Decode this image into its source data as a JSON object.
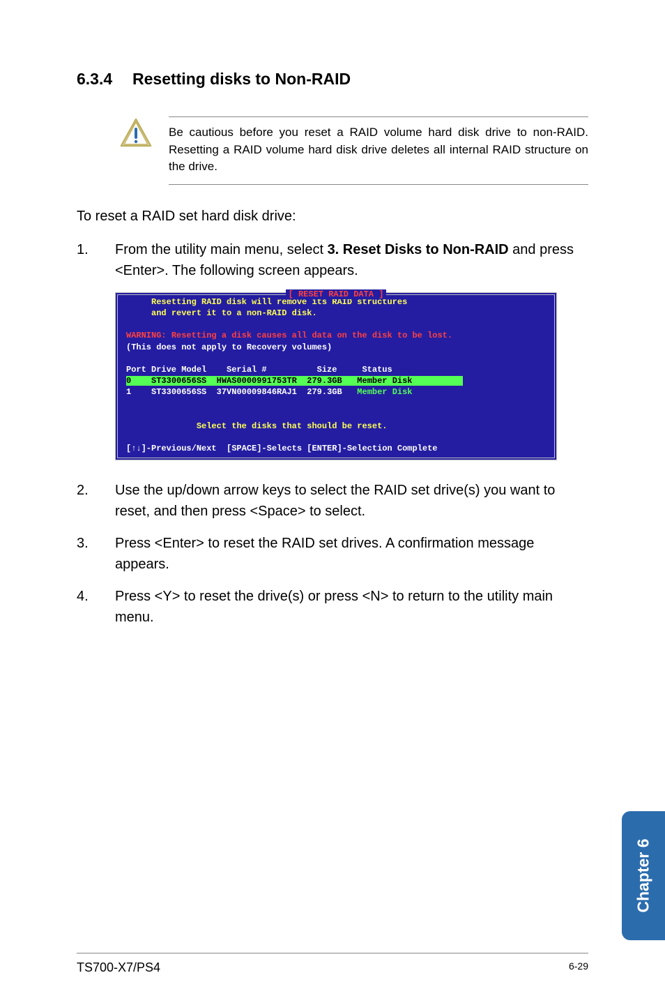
{
  "section_number": "6.3.4",
  "section_title": "Resetting disks to Non-RAID",
  "note_text": "Be cautious before you reset a RAID volume hard disk drive to non-RAID. Resetting a RAID volume hard disk drive deletes all internal RAID structure on the drive.",
  "intro_text": "To reset a RAID set hard disk drive:",
  "step1": {
    "num": "1.",
    "pre": "From the utility main menu, select ",
    "bold": "3. Reset Disks to Non-RAID",
    "post": " and press <Enter>. The following screen appears."
  },
  "terminal": {
    "title": "[ RESET RAID DATA ]",
    "msg1": "Resetting RAID disk will remove its RAID structures",
    "msg2": "and revert it to a non-RAID disk.",
    "warn_prefix": "WARNING: ",
    "warn_rest": "Resetting a disk causes all data on the disk to be lost.",
    "recovery": "(This does not apply to Recovery volumes)",
    "header": "Port Drive Model    Serial #          Size     Status",
    "row0": {
      "port": "0",
      "model": "ST3300656SS",
      "serial": "HWAS0000991753TR",
      "size": "279.3GB",
      "status": "Member Disk"
    },
    "row1": {
      "port": "1",
      "model": "ST3300656SS",
      "serial": "37VN00009846RAJ1",
      "size": "279.3GB",
      "status": "Member Disk"
    },
    "select_prompt": "Select the disks that should be reset.",
    "footer": "[↑↓]-Previous/Next  [SPACE]-Selects [ENTER]-Selection Complete"
  },
  "step2": {
    "num": "2.",
    "text": "Use the up/down arrow keys to select the RAID set drive(s) you want to reset, and then press <Space> to select."
  },
  "step3": {
    "num": "3.",
    "text": "Press <Enter> to reset the RAID set drives. A confirmation message appears."
  },
  "step4": {
    "num": "4.",
    "text": "Press <Y> to reset the drive(s) or press <N> to return to the utility main menu."
  },
  "chapter_tab": "Chapter 6",
  "footer_left": "TS700-X7/PS4",
  "footer_right": "6-29"
}
